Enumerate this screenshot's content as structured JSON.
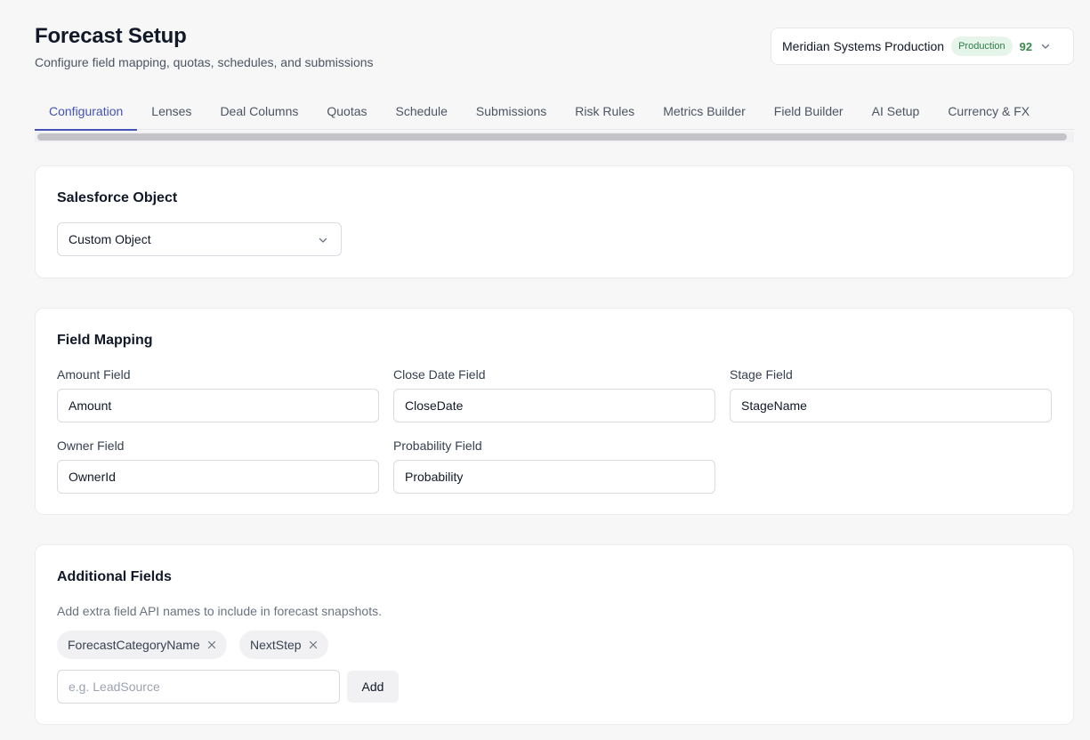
{
  "header": {
    "title": "Forecast Setup",
    "subtitle": "Configure field mapping, quotas, schedules, and submissions"
  },
  "org_selector": {
    "name": "Meridian Systems Production",
    "badge": "Production",
    "score": "92",
    "chevron_icon": "chevron-down-icon"
  },
  "tabs": [
    {
      "label": "Configuration",
      "active": true
    },
    {
      "label": "Lenses"
    },
    {
      "label": "Deal Columns"
    },
    {
      "label": "Quotas"
    },
    {
      "label": "Schedule"
    },
    {
      "label": "Submissions"
    },
    {
      "label": "Risk Rules"
    },
    {
      "label": "Metrics Builder"
    },
    {
      "label": "Field Builder"
    },
    {
      "label": "AI Setup"
    },
    {
      "label": "Currency & FX"
    }
  ],
  "salesforce_object": {
    "title": "Salesforce Object",
    "selected": "Custom Object"
  },
  "field_mapping": {
    "title": "Field Mapping",
    "amount": {
      "label": "Amount Field",
      "value": "Amount"
    },
    "close_date": {
      "label": "Close Date Field",
      "value": "CloseDate"
    },
    "stage": {
      "label": "Stage Field",
      "value": "StageName"
    },
    "owner": {
      "label": "Owner Field",
      "value": "OwnerId"
    },
    "probability": {
      "label": "Probability Field",
      "value": "Probability"
    }
  },
  "additional_fields": {
    "title": "Additional Fields",
    "helper": "Add extra field API names to include in forecast snapshots.",
    "chips": [
      {
        "label": "ForecastCategoryName"
      },
      {
        "label": "NextStep"
      }
    ],
    "input_placeholder": "e.g. LeadSource",
    "add_label": "Add"
  },
  "colors": {
    "accent": "#4353b8",
    "badge_bg": "#e6f5ea",
    "badge_text": "#2f7d46",
    "page_bg": "#f7f7f8"
  }
}
